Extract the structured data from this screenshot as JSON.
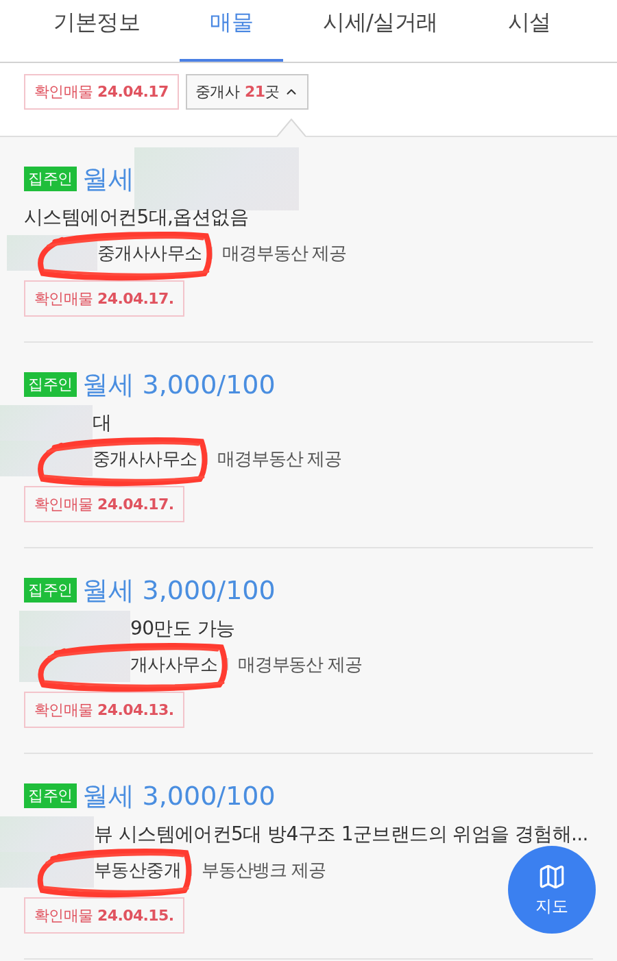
{
  "tabs": [
    {
      "label": "기본정보",
      "selected": false
    },
    {
      "label": "매물",
      "selected": true
    },
    {
      "label": "시세/실거래",
      "selected": false
    },
    {
      "label": "시설",
      "selected": false
    }
  ],
  "filter_bar": {
    "confirmed_chip": "확인매물 **24.04.17**",
    "agents_button": {
      "label": "중개사",
      "count": "21",
      "unit": "곳",
      "expanded": true
    }
  },
  "listings": [
    {
      "badge": "집주인",
      "title": {
        "text": "월세",
        "redacted": true
      },
      "description": {
        "text": "시스템에어컨5대,옵션없음",
        "redacted": false
      },
      "agency": {
        "text": "중개사사무소",
        "redacted": true,
        "circled": true
      },
      "source": "매경부동산 제공",
      "confirmed": "확인매물 **24.04.17.**"
    },
    {
      "badge": "집주인",
      "title": {
        "text": "월세 3,000/100",
        "redacted": false
      },
      "description": {
        "text": "대",
        "redacted": true
      },
      "agency": {
        "text": "중개사사무소",
        "redacted": true,
        "circled": true
      },
      "source": "매경부동산 제공",
      "confirmed": "확인매물 **24.04.17.**"
    },
    {
      "badge": "집주인",
      "title": {
        "text": "월세 3,000/100",
        "redacted": false
      },
      "description": {
        "text": "90만도 가능",
        "redacted": true
      },
      "agency": {
        "text": "개사사무소",
        "redacted": true,
        "circled": true
      },
      "source": "매경부동산 제공",
      "confirmed": "확인매물 **24.04.13.**"
    },
    {
      "badge": "집주인",
      "title": {
        "text": "월세 3,000/100",
        "redacted": false
      },
      "description": {
        "text": "뷰 시스템에어컨5대 방4구조 1군브랜드의 위엄을 경험해...",
        "redacted": true
      },
      "agency": {
        "text": "부동산중개",
        "redacted": true,
        "circled": true
      },
      "source": "부동산뱅크 제공",
      "confirmed": "확인매물 **24.04.15.**"
    }
  ],
  "map_button": {
    "label": "지도"
  }
}
